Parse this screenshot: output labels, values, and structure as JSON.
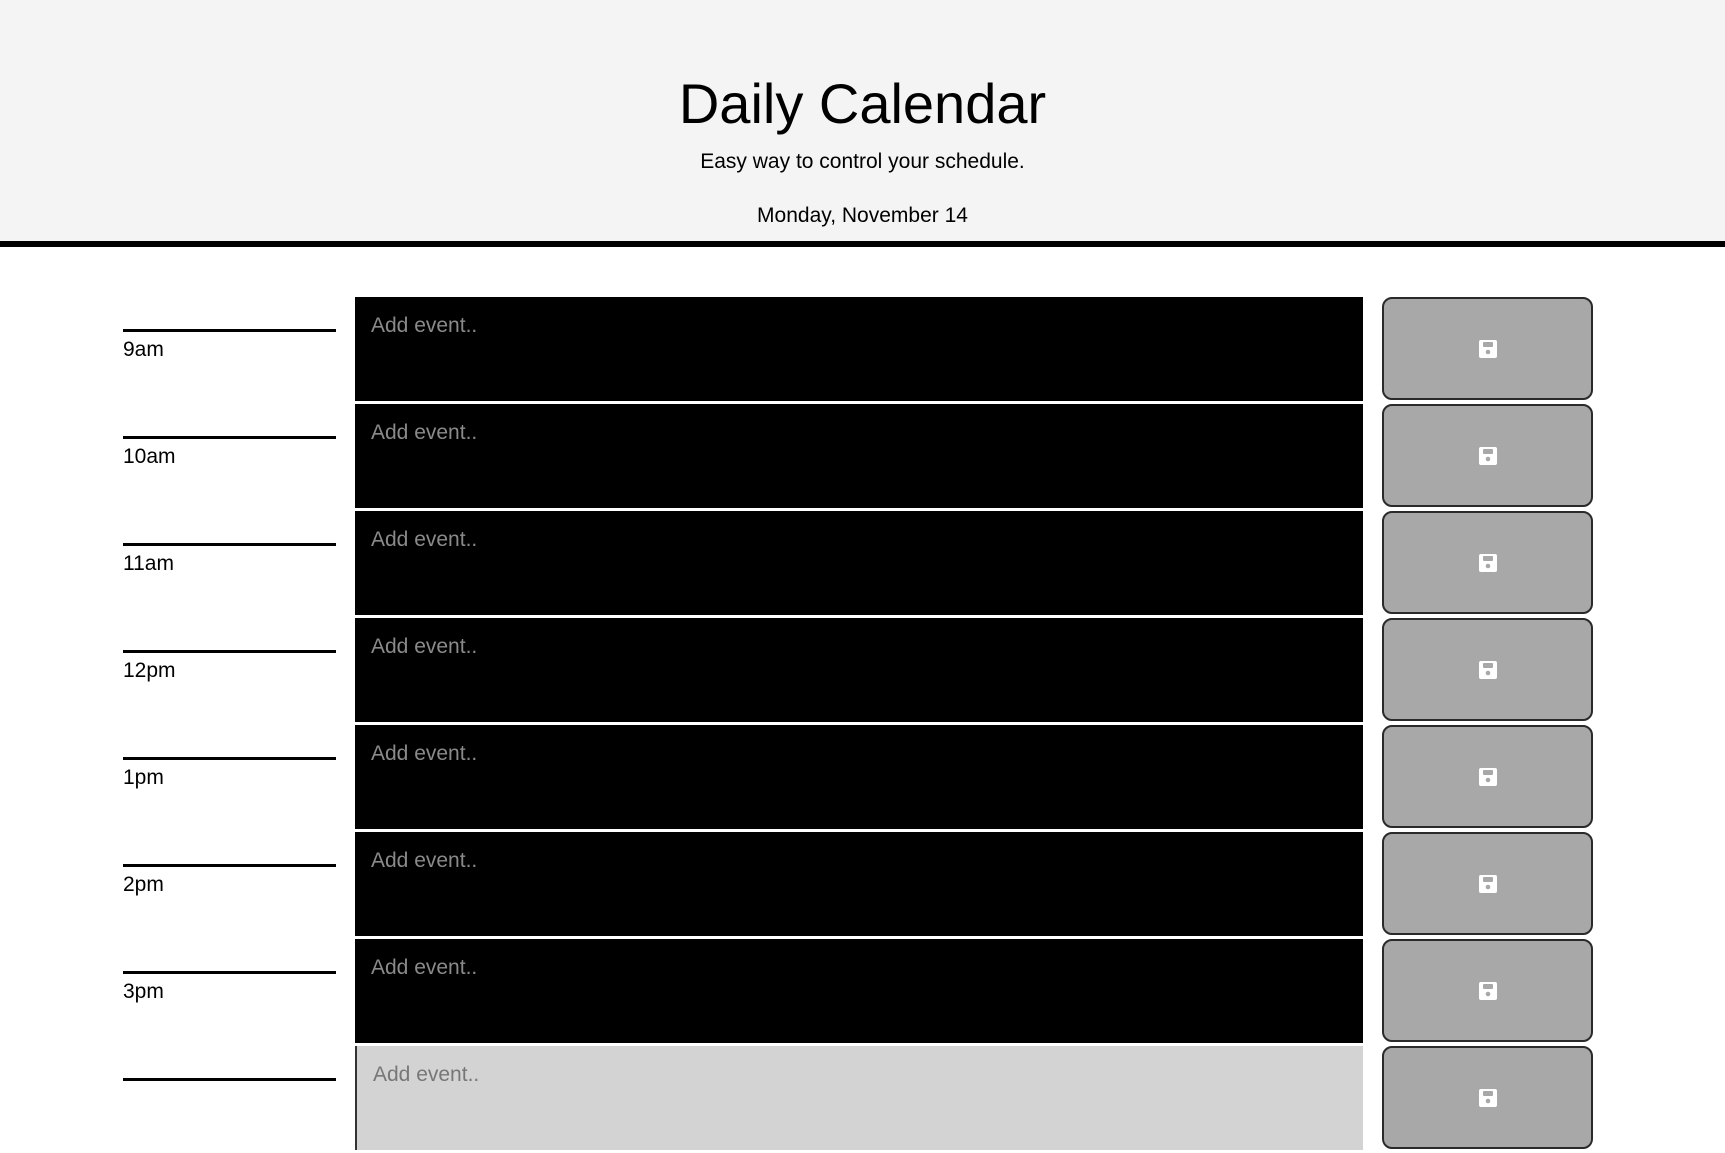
{
  "header": {
    "title": "Daily Calendar",
    "lead": "Easy way to control your schedule.",
    "current_day": "Monday, November 14"
  },
  "colors": {
    "past": "#000000",
    "present": "#d3d3d3",
    "save_button": "#a8a8a8"
  },
  "time_blocks": [
    {
      "hour": "9am",
      "placeholder": "Add event..",
      "value": "",
      "state": "past",
      "save_icon": "save-icon"
    },
    {
      "hour": "10am",
      "placeholder": "Add event..",
      "value": "",
      "state": "past",
      "save_icon": "save-icon"
    },
    {
      "hour": "11am",
      "placeholder": "Add event..",
      "value": "",
      "state": "past",
      "save_icon": "save-icon"
    },
    {
      "hour": "12pm",
      "placeholder": "Add event..",
      "value": "",
      "state": "past",
      "save_icon": "save-icon"
    },
    {
      "hour": "1pm",
      "placeholder": "Add event..",
      "value": "",
      "state": "past",
      "save_icon": "save-icon"
    },
    {
      "hour": "2pm",
      "placeholder": "Add event..",
      "value": "",
      "state": "past",
      "save_icon": "save-icon"
    },
    {
      "hour": "3pm",
      "placeholder": "Add event..",
      "value": "",
      "state": "past",
      "save_icon": "save-icon"
    },
    {
      "hour": "",
      "placeholder": "Add event..",
      "value": "",
      "state": "present",
      "save_icon": "save-icon"
    }
  ]
}
